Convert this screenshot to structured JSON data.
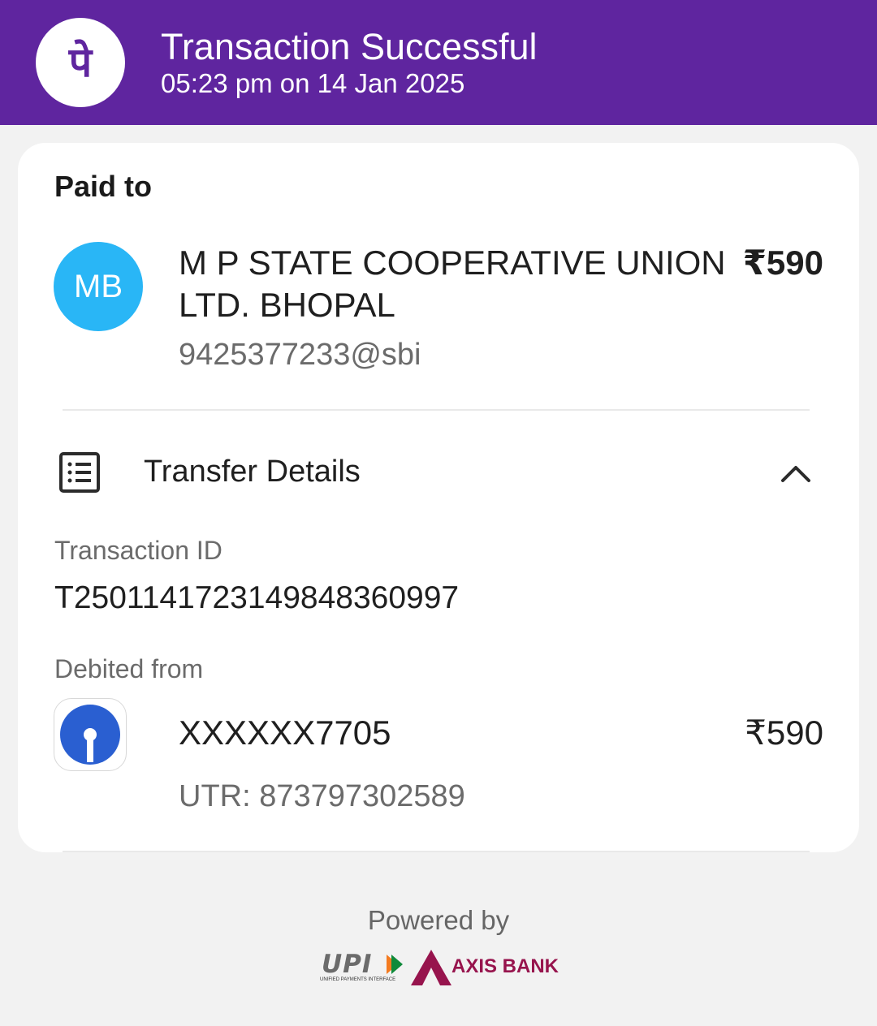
{
  "header": {
    "title": "Transaction Successful",
    "datetime": "05:23 pm on 14 Jan 2025",
    "logo_icon": "phonepe-logo-icon",
    "logo_glyph": "पे",
    "bg_color": "#5f259f"
  },
  "payee": {
    "section_label": "Paid to",
    "avatar_initials": "MB",
    "avatar_color": "#29b6f6",
    "name": "M P STATE COOPERATIVE UNION LTD. BHOPAL",
    "amount": "₹590",
    "upi_id": "9425377233@sbi"
  },
  "transfer_details": {
    "title": "Transfer Details",
    "icon": "receipt-list-icon",
    "toggle_icon": "chevron-up-icon",
    "transaction_id_label": "Transaction ID",
    "transaction_id": "T2501141723149848360997",
    "debited_from_label": "Debited from",
    "bank_icon": "sbi-logo-icon",
    "account": "XXXXXX7705",
    "amount": "₹590",
    "utr": "UTR: 873797302589"
  },
  "footer": {
    "powered_by": "Powered by",
    "upi_logo_text": "UPI",
    "upi_subtitle": "UNIFIED PAYMENTS INTERFACE",
    "bank_name": "AXIS BANK",
    "bank_color": "#97144d"
  }
}
